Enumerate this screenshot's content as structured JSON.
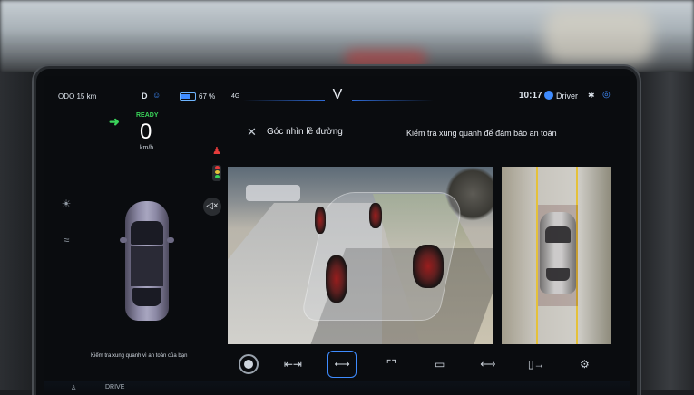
{
  "status_bar": {
    "odo": "ODO 15 km",
    "gear": "D",
    "battery_percent": 67,
    "battery_label": "67 %",
    "network": "4G",
    "time": "10:17",
    "profile": "Driver"
  },
  "cluster": {
    "ready": "READY",
    "speed": "0",
    "speed_unit": "km/h",
    "safety_message": "Kiểm tra xung quanh vì an toàn của bạn"
  },
  "camera": {
    "title": "Góc nhìn lề đường",
    "hint": "Kiểm tra xung quanh để đảm bảo an toàn"
  },
  "dock": {
    "drive_label": "DRIVE"
  },
  "colors": {
    "accent": "#3f8cff",
    "ready_green": "#3ad45a",
    "warning_red": "#e53b3b",
    "guide_yellow": "#e5c13a"
  }
}
